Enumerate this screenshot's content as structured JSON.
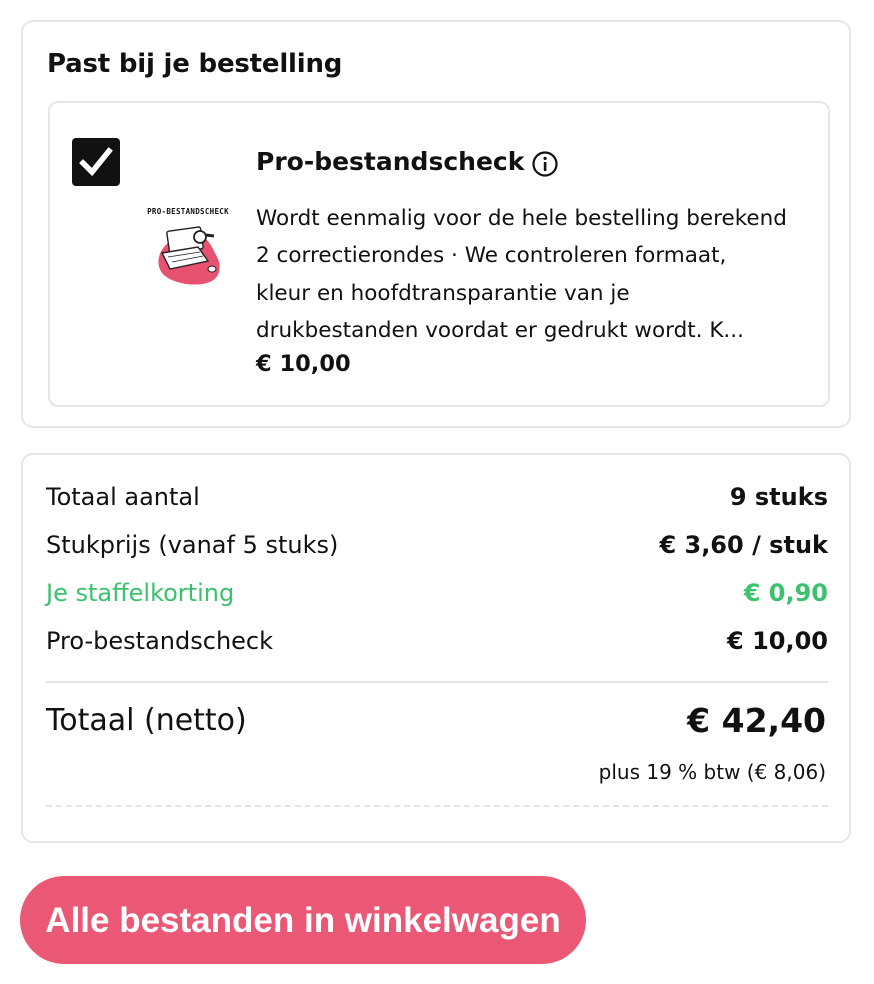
{
  "upsell": {
    "title": "Past bij je bestelling",
    "addon": {
      "checked": true,
      "image_label": "PRO-BESTANDSCHECK",
      "title": "Pro-bestandscheck",
      "description_lines": [
        "Wordt eenmalig voor de hele bestelling berekend",
        "2 correctierondes · We controleren formaat,",
        "kleur en hoofdtransparantie van je",
        "drukbestanden voordat er gedrukt wordt. K..."
      ],
      "price": "€ 10,00",
      "icons": {
        "checkbox": "checkmark-icon",
        "info": "info-icon",
        "image": "laptop-magnifier-illustration"
      }
    }
  },
  "summary": {
    "rows": [
      {
        "label": "Totaal aantal",
        "value": "9 stuks"
      },
      {
        "label": "Stukprijs (vanaf 5 stuks)",
        "value": "€ 3,60 / stuk"
      },
      {
        "label": "Je staffelkorting",
        "value": "€ 0,90"
      },
      {
        "label": "Pro-bestandscheck",
        "value": "€ 10,00"
      }
    ],
    "total_label": "Totaal (netto)",
    "total_value": "€ 42,40",
    "vat_note": "plus 19 % btw (€ 8,06)"
  },
  "cta": {
    "label": "Alle bestanden in winkelwagen"
  },
  "colors": {
    "accent": "#ea5876",
    "discount": "#3cc26e",
    "border": "#e6e6e6",
    "text": "#111111"
  }
}
